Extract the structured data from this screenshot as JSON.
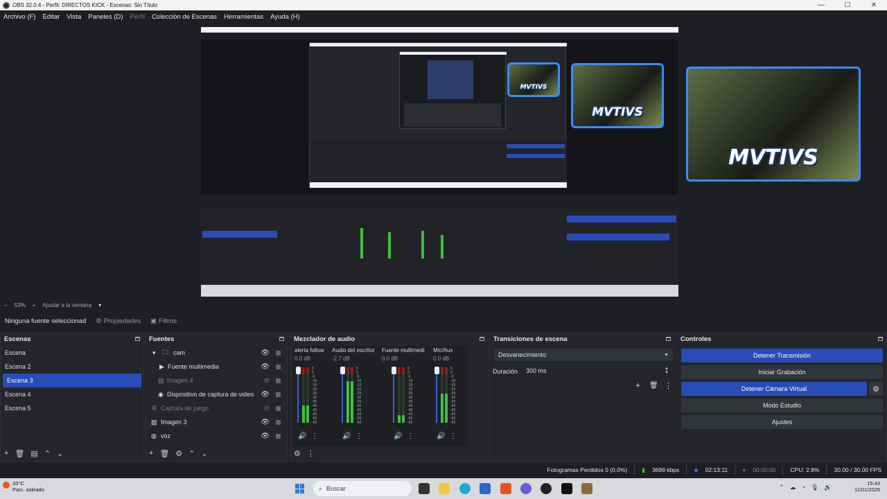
{
  "window": {
    "title": "OBS 32.0.4 - Perfil: DIRECTOS KICK - Escenas: Sin Título",
    "min": "—",
    "max": "☐",
    "close": "✕"
  },
  "menu": [
    "Archivo (F)",
    "Editar",
    "Vista",
    "Paneles (D)",
    "Perfil",
    "Colección de Escenas",
    "Herramientas",
    "Ayuda (H)"
  ],
  "preview": {
    "overlay_text": "MVTIVS"
  },
  "zoom": {
    "minus": "−",
    "level": "53%",
    "plus": "+",
    "fit": "Ajustar a la ventana"
  },
  "source_toolbar": {
    "no_source": "Ninguna fuente seleccionad",
    "properties": "Propiedades",
    "filters": "Filtros"
  },
  "scenes": {
    "title": "Escenas",
    "items": [
      "Escena",
      "Escena 2",
      "Escena 3",
      "Escena 4",
      "Escena 5"
    ],
    "selected": "Escena 3"
  },
  "sources": {
    "title": "Fuentes",
    "items": [
      {
        "label": "cam",
        "icon": "folder-icon",
        "dim": false
      },
      {
        "label": "Fuente multimedia",
        "icon": "play-icon",
        "dim": false
      },
      {
        "label": "Imagen 4",
        "icon": "image-icon",
        "dim": true
      },
      {
        "label": "Dispositivo de captura de video",
        "icon": "camera-icon",
        "dim": false
      },
      {
        "label": "Captura de juego",
        "icon": "gamepad-icon",
        "dim": true
      },
      {
        "label": "Imagen 3",
        "icon": "image-icon",
        "dim": false
      },
      {
        "label": "voz",
        "icon": "globe-icon",
        "dim": false
      }
    ]
  },
  "mixer": {
    "title": "Mezclador de audio",
    "channels": [
      {
        "name": "alerta follow",
        "db": "0.0 dB",
        "level": 0.35
      },
      {
        "name": "Audio del escritorio",
        "db": "-2.7 dB",
        "level": 0.85
      },
      {
        "name": "Fuente multimedia",
        "db": "0.0 dB",
        "level": 0.15
      },
      {
        "name": "Mic/Aux",
        "db": "0.0 dB",
        "level": 0.6
      }
    ],
    "scale": [
      "5",
      "0",
      "-5",
      "-10",
      "-15",
      "-20",
      "-25",
      "-30",
      "-35",
      "-40",
      "-45",
      "-50",
      "-55",
      "-60"
    ]
  },
  "transitions": {
    "title": "Transiciones de escena",
    "selected": "Desvanecimiento",
    "duration_label": "Duración",
    "duration_value": "300 ms"
  },
  "controls": {
    "title": "Controles",
    "buttons": [
      "Detener Transmisión",
      "Iniciar Grabación",
      "Detener Cámara Virtual",
      "Modo Estudio",
      "Ajustes"
    ]
  },
  "status": {
    "dropped": "Fotogramas Perdidos 0 (0.0%)",
    "bitrate": "3699 kbps",
    "stream_time": "02:13:11",
    "rec_time": "00:00:00",
    "cpu": "CPU: 2.8%",
    "fps": "30.00 / 30.00 FPS"
  },
  "taskbar": {
    "weather_temp": "33°C",
    "weather_desc": "Parc. soleado",
    "search": "Buscar",
    "time": "15:43",
    "date": "11/01/2026"
  },
  "colors": {
    "accent": "#284cb8",
    "panel": "#25262b",
    "background": "#1e1f23"
  }
}
